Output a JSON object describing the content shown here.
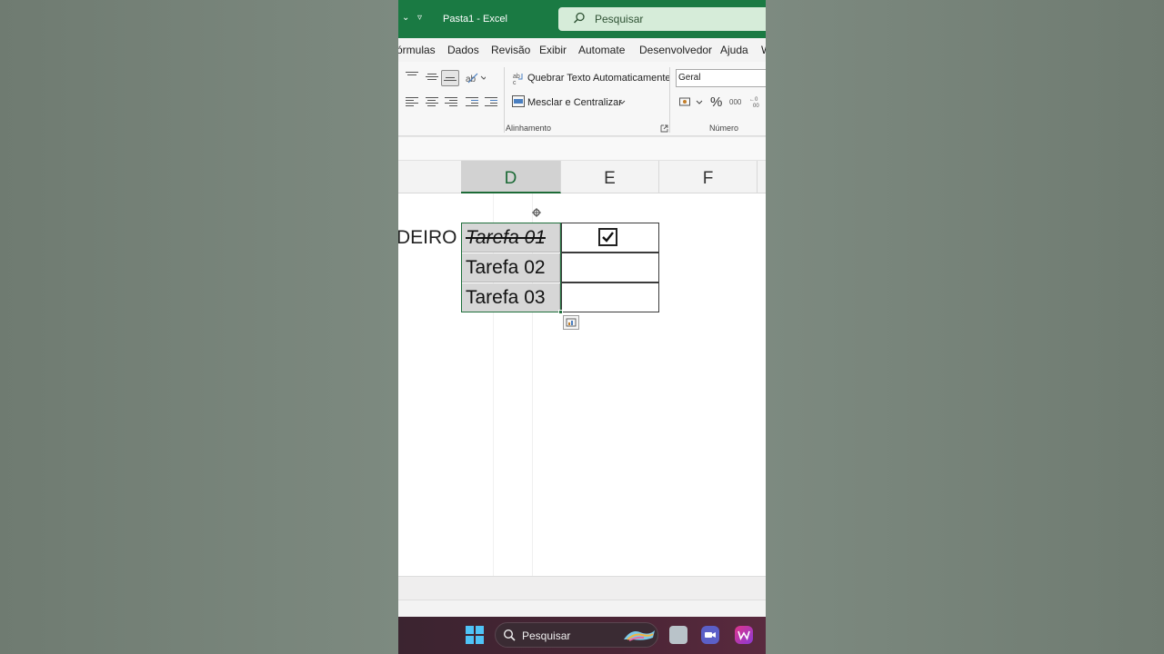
{
  "titlebar": {
    "qa_dropdown": "⌄",
    "qa_customize": "▿",
    "document_title": "Pasta1  -  Excel",
    "search_placeholder": "Pesquisar"
  },
  "tabs": [
    "órmulas",
    "Dados",
    "Revisão",
    "Exibir",
    "Automate",
    "Desenvolvedor",
    "Ajuda",
    "W"
  ],
  "ribbon": {
    "wrap_text": "Quebrar Texto Automaticamente",
    "merge_center": "Mesclar e Centralizar",
    "group_alignment": "Alinhamento",
    "number_format": "Geral",
    "percent": "%",
    "thousands": "000",
    "group_number": "Número"
  },
  "columns": [
    "D",
    "E",
    "F"
  ],
  "sheet": {
    "row_label_partial": "DEIRO",
    "tasks": [
      {
        "text": "Tarefa 01",
        "done": true
      },
      {
        "text": "Tarefa 02",
        "done": false
      },
      {
        "text": "Tarefa 03",
        "done": false
      }
    ]
  },
  "taskbar": {
    "search_placeholder": "Pesquisar"
  },
  "colors": {
    "excel_green": "#1a7a43",
    "selection_green": "#1e6e3a",
    "accent_blue": "#4fc3f7"
  }
}
